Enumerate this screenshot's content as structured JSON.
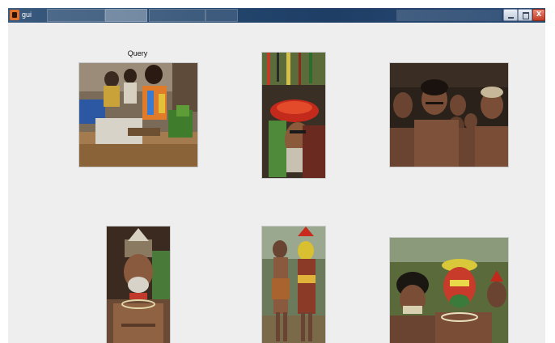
{
  "window": {
    "title": "gui"
  },
  "query_label": "Query",
  "images": [
    {
      "name": "query-image",
      "scene": "market-vendors"
    },
    {
      "name": "result-image-1",
      "scene": "headdress-closeup"
    },
    {
      "name": "result-image-2",
      "scene": "group-of-men"
    },
    {
      "name": "result-image-3",
      "scene": "elder-portrait"
    },
    {
      "name": "result-image-4",
      "scene": "two-dancers"
    },
    {
      "name": "result-image-5",
      "scene": "painted-faces"
    }
  ],
  "colors": {
    "window_bg": "#eeeeee",
    "titlebar": "#24466d",
    "close_button": "#c23b22"
  },
  "icons": [
    "app-icon",
    "minimize-icon",
    "maximize-icon",
    "close-icon"
  ]
}
